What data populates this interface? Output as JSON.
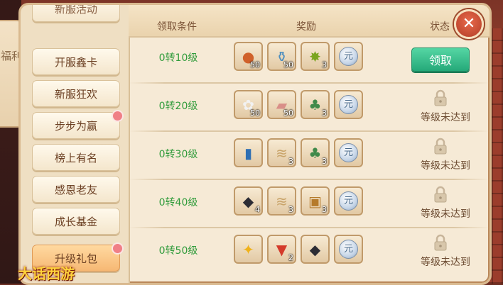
{
  "side_tab": {
    "label": "福利"
  },
  "menu": [
    {
      "label": "新服活动"
    },
    {
      "label": "开服鑫卡"
    },
    {
      "label": "新服狂欢"
    },
    {
      "label": "步步为赢"
    },
    {
      "label": "榜上有名"
    },
    {
      "label": "感恩老友"
    },
    {
      "label": "成长基金"
    },
    {
      "label": "升级礼包"
    }
  ],
  "headers": {
    "condition": "领取条件",
    "reward": "奖励",
    "status": "状态"
  },
  "rows": [
    {
      "condition": "0转10级",
      "items": [
        {
          "icon": "orange-bead-icon",
          "glyph": "●",
          "color": "#d0612a",
          "count": "50"
        },
        {
          "icon": "potion-bottle-icon",
          "glyph": "⚱",
          "color": "#4f8fbf",
          "count": "50"
        },
        {
          "icon": "green-star-fruit-icon",
          "glyph": "✸",
          "color": "#7aa51f",
          "count": "3"
        },
        {
          "icon": "silver-coin-icon",
          "glyph": "元",
          "color": "#4a6b8c",
          "count": ""
        }
      ],
      "status_button": "领取",
      "status_text": ""
    },
    {
      "condition": "0转20级",
      "items": [
        {
          "icon": "white-flower-icon",
          "glyph": "✿",
          "color": "#f2f2f2",
          "count": "50"
        },
        {
          "icon": "pink-scroll-icon",
          "glyph": "▰",
          "color": "#d98f88",
          "count": "50"
        },
        {
          "icon": "bonsai-vase-icon",
          "glyph": "♣",
          "color": "#3f8a4a",
          "count": "3"
        },
        {
          "icon": "silver-coin-icon",
          "glyph": "元",
          "color": "#4a6b8c",
          "count": ""
        }
      ],
      "status_button": "",
      "status_text": "等级未达到"
    },
    {
      "condition": "0转30级",
      "items": [
        {
          "icon": "blue-book-icon",
          "glyph": "▮",
          "color": "#2f6fb3",
          "count": ""
        },
        {
          "icon": "paper-scroll-icon",
          "glyph": "≋",
          "color": "#c9a46a",
          "count": "3"
        },
        {
          "icon": "bonsai-vase-icon",
          "glyph": "♣",
          "color": "#3f8a4a",
          "count": "3"
        },
        {
          "icon": "silver-coin-icon",
          "glyph": "元",
          "color": "#4a6b8c",
          "count": ""
        }
      ],
      "status_button": "",
      "status_text": "等级未达到"
    },
    {
      "condition": "0转40级",
      "items": [
        {
          "icon": "black-stone-icon",
          "glyph": "◆",
          "color": "#2c2c34",
          "count": "4"
        },
        {
          "icon": "paper-scroll-icon",
          "glyph": "≋",
          "color": "#c9a46a",
          "count": "3"
        },
        {
          "icon": "treasure-chest-icon",
          "glyph": "▣",
          "color": "#b57a2a",
          "count": "3"
        },
        {
          "icon": "silver-coin-icon",
          "glyph": "元",
          "color": "#4a6b8c",
          "count": ""
        }
      ],
      "status_button": "",
      "status_text": "等级未达到"
    },
    {
      "condition": "0转50级",
      "items": [
        {
          "icon": "yellow-star-icon",
          "glyph": "✦",
          "color": "#f0b21a",
          "count": ""
        },
        {
          "icon": "red-gem-icon",
          "glyph": "▼",
          "color": "#d43a2a",
          "count": "2"
        },
        {
          "icon": "black-stone-icon",
          "glyph": "◆",
          "color": "#2c2c34",
          "count": ""
        },
        {
          "icon": "silver-coin-icon",
          "glyph": "元",
          "color": "#4a6b8c",
          "count": ""
        }
      ],
      "status_button": "",
      "status_text": "等级未达到"
    }
  ],
  "close_label": "✕",
  "logo": {
    "title": "大话西游"
  }
}
